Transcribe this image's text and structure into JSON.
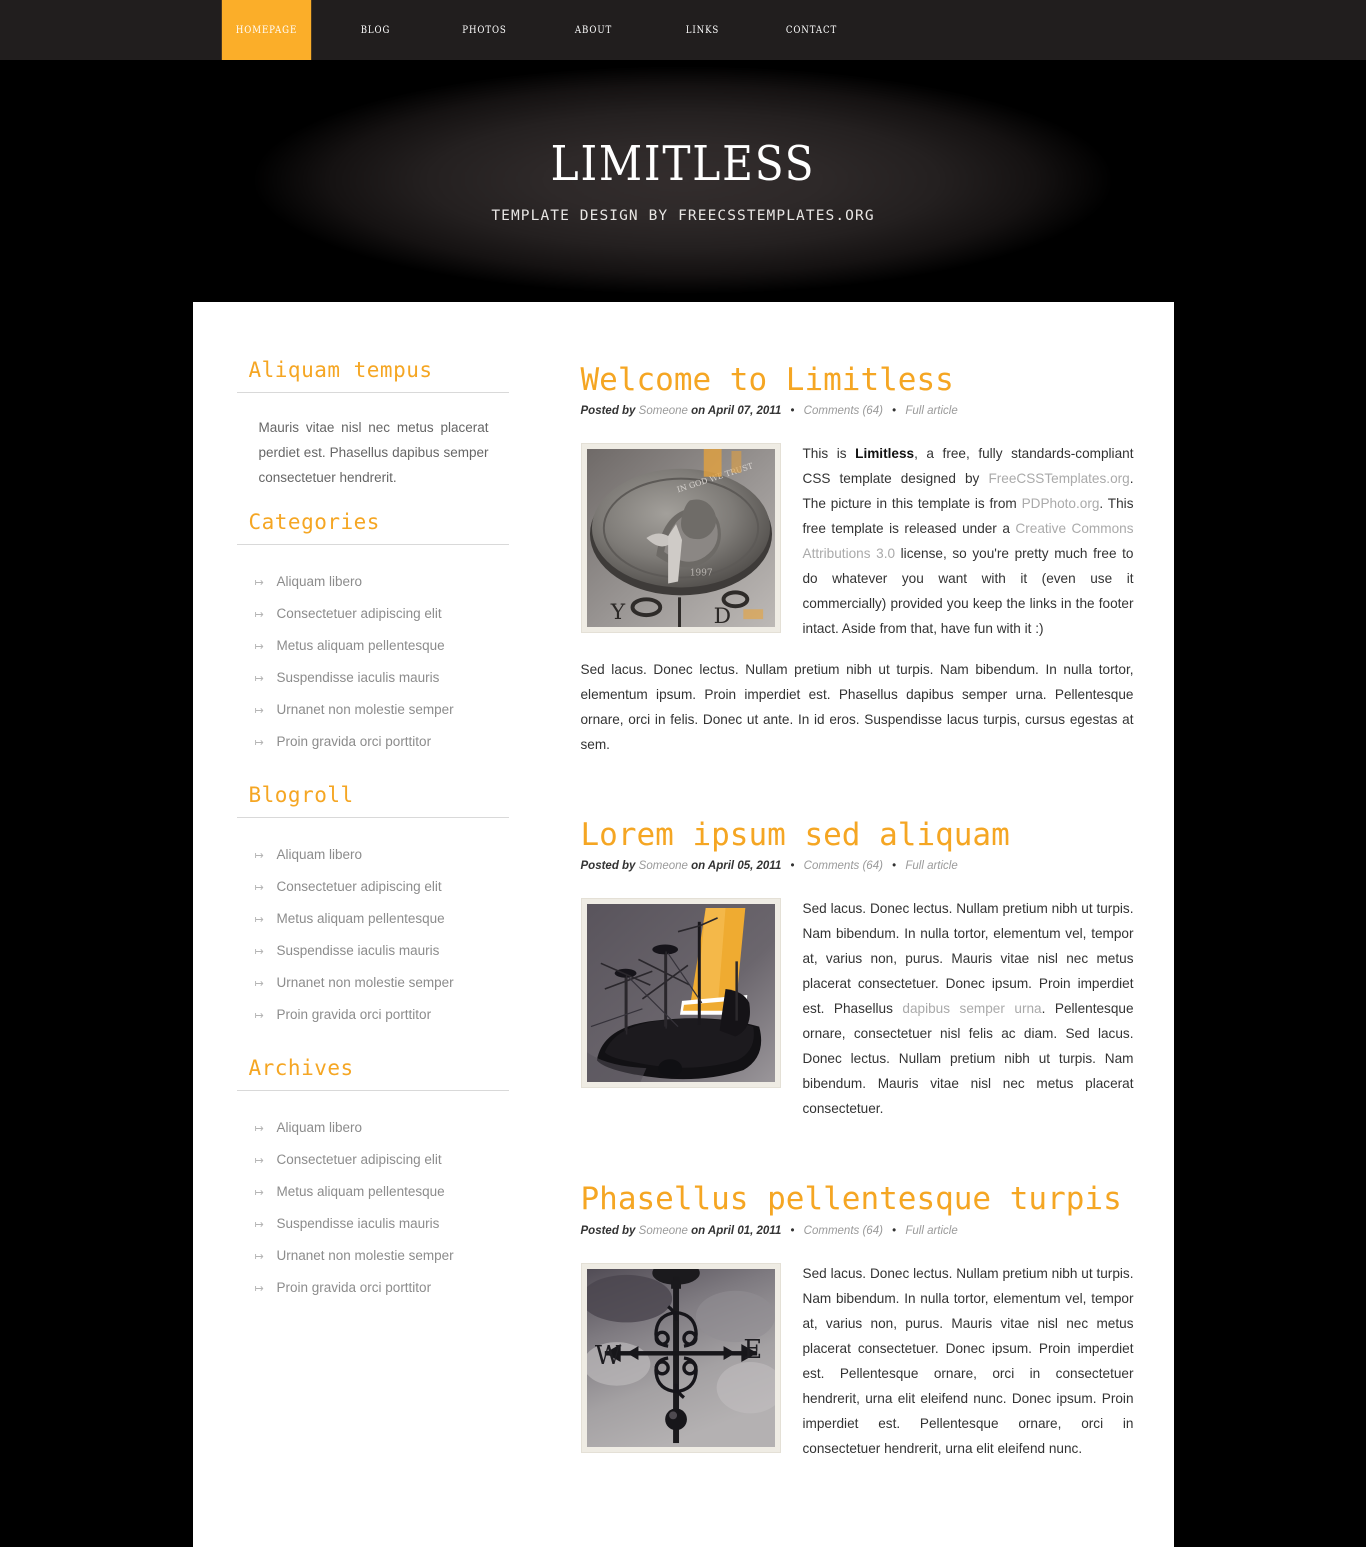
{
  "nav": {
    "items": [
      {
        "label": "Homepage",
        "active": true
      },
      {
        "label": "Blog",
        "active": false
      },
      {
        "label": "Photos",
        "active": false
      },
      {
        "label": "About",
        "active": false
      },
      {
        "label": "Links",
        "active": false
      },
      {
        "label": "Contact",
        "active": false
      }
    ]
  },
  "banner": {
    "title": "LIMITLESS",
    "tagline": "TEMPLATE DESIGN BY FREECSSTEMPLATES.ORG"
  },
  "sidebar": {
    "blocks": [
      {
        "title": "Aliquam tempus",
        "type": "text",
        "text": "Mauris vitae nisl nec metus placerat perdiet est. Phasellus dapibus semper consectetuer hendrerit."
      },
      {
        "title": "Categories",
        "type": "list",
        "items": [
          "Aliquam libero",
          "Consectetuer adipiscing elit",
          "Metus aliquam pellentesque",
          "Suspendisse iaculis mauris",
          "Urnanet non molestie semper",
          "Proin gravida orci porttitor"
        ]
      },
      {
        "title": "Blogroll",
        "type": "list",
        "items": [
          "Aliquam libero",
          "Consectetuer adipiscing elit",
          "Metus aliquam pellentesque",
          "Suspendisse iaculis mauris",
          "Urnanet non molestie semper",
          "Proin gravida orci porttitor"
        ]
      },
      {
        "title": "Archives",
        "type": "list",
        "items": [
          "Aliquam libero",
          "Consectetuer adipiscing elit",
          "Metus aliquam pellentesque",
          "Suspendisse iaculis mauris",
          "Urnanet non molestie semper",
          "Proin gravida orci porttitor"
        ]
      }
    ],
    "bullet_icon": "arrow-right-icon",
    "bullet_glyph": "↦"
  },
  "posts": [
    {
      "title": "Welcome to Limitless",
      "meta": {
        "posted_by_label": "Posted by",
        "author": "Someone",
        "on_date": "on April 07, 2011",
        "separator": "•",
        "comments": "Comments (64)",
        "full_article": "Full article"
      },
      "image": "coin-penny-photo",
      "paragraphs": [
        "This is Limitless, a free, fully standards-compliant CSS template designed by FreeCSSTemplates.org. The picture in this template is from PDPhoto.org. This free template is released under a Creative Commons Attributions 3.0 license, so you're pretty much free to do whatever you want with it (even use it commercially) provided you keep the links in the footer intact. Aside from that, have fun with it :)",
        "Sed lacus. Donec lectus. Nullam pretium nibh ut turpis. Nam bibendum. In nulla tortor, elementum ipsum. Proin imperdiet est. Phasellus dapibus semper urna. Pellentesque ornare, orci in felis. Donec ut ante. In id eros. Suspendisse lacus turpis, cursus egestas at sem."
      ],
      "inline_bold": [
        "Limitless"
      ],
      "inline_links": [
        "FreeCSSTemplates.org",
        "PDPhoto.org",
        "Creative Commons Attributions 3.0"
      ]
    },
    {
      "title": "Lorem ipsum sed aliquam",
      "meta": {
        "posted_by_label": "Posted by",
        "author": "Someone",
        "on_date": "on April 05, 2011",
        "separator": "•",
        "comments": "Comments (64)",
        "full_article": "Full article"
      },
      "image": "sailing-ship-photo",
      "paragraphs": [
        "Sed lacus. Donec lectus. Nullam pretium nibh ut turpis. Nam bibendum. In nulla tortor, elementum vel, tempor at, varius non, purus. Mauris vitae nisl nec metus placerat consectetuer. Donec ipsum. Proin imperdiet est. Phasellus dapibus semper urna. Pellentesque ornare, consectetuer nisl felis ac diam. Sed lacus. Donec lectus. Nullam pretium nibh ut turpis. Nam bibendum. Mauris vitae nisl nec metus placerat consectetuer."
      ],
      "inline_links": [
        "dapibus semper urna"
      ]
    },
    {
      "title": "Phasellus pellentesque turpis",
      "meta": {
        "posted_by_label": "Posted by",
        "author": "Someone",
        "on_date": "on April 01, 2011",
        "separator": "•",
        "comments": "Comments (64)",
        "full_article": "Full article"
      },
      "image": "weathervane-photo",
      "paragraphs": [
        "Sed lacus. Donec lectus. Nullam pretium nibh ut turpis. Nam bibendum. In nulla tortor, elementum vel, tempor at, varius non, purus. Mauris vitae nisl nec metus placerat consectetuer. Donec ipsum. Proin imperdiet est. Pellentesque ornare, orci in consectetuer hendrerit, urna elit eleifend nunc. Donec ipsum. Proin imperdiet est. Pellentesque ornare, orci in consectetuer hendrerit, urna elit eleifend nunc."
      ]
    }
  ],
  "colors": {
    "accent": "#F5A623",
    "nav_active": "#FBAE29",
    "nav_bg": "#211E1E",
    "page_bg": "#000000",
    "panel_bg": "#FFFFFF",
    "body_text": "#333333",
    "link": "#AAAAAA",
    "muted": "#8C8C8C"
  }
}
